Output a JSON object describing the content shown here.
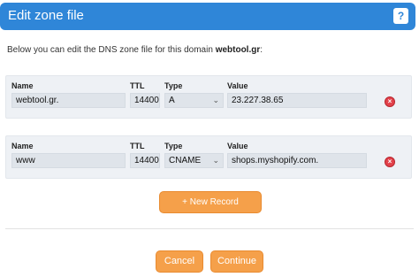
{
  "header": {
    "title": "Edit zone file",
    "help_label": "?"
  },
  "intro": {
    "text": "Below you can edit the DNS zone file for this domain ",
    "domain": "webtool.gr",
    "suffix": ":"
  },
  "columns": {
    "name": "Name",
    "ttl": "TTL",
    "type": "Type",
    "value": "Value"
  },
  "records": [
    {
      "name": "webtool.gr.",
      "ttl": "14400",
      "type": "A",
      "value": "23.227.38.65"
    },
    {
      "name": "www",
      "ttl": "14400",
      "type": "CNAME",
      "value": "shops.myshopify.com."
    }
  ],
  "icons": {
    "delete": "delete-icon",
    "chevron": "chevron-down-icon",
    "help": "help-icon"
  },
  "colors": {
    "header_bg": "#2f86d8",
    "button_bg": "#f5a04a",
    "delete_red": "#e2424b",
    "record_bg": "#eef1f5"
  },
  "actions": {
    "new_record": "+ New Record",
    "cancel": "Cancel",
    "continue": "Continue"
  }
}
